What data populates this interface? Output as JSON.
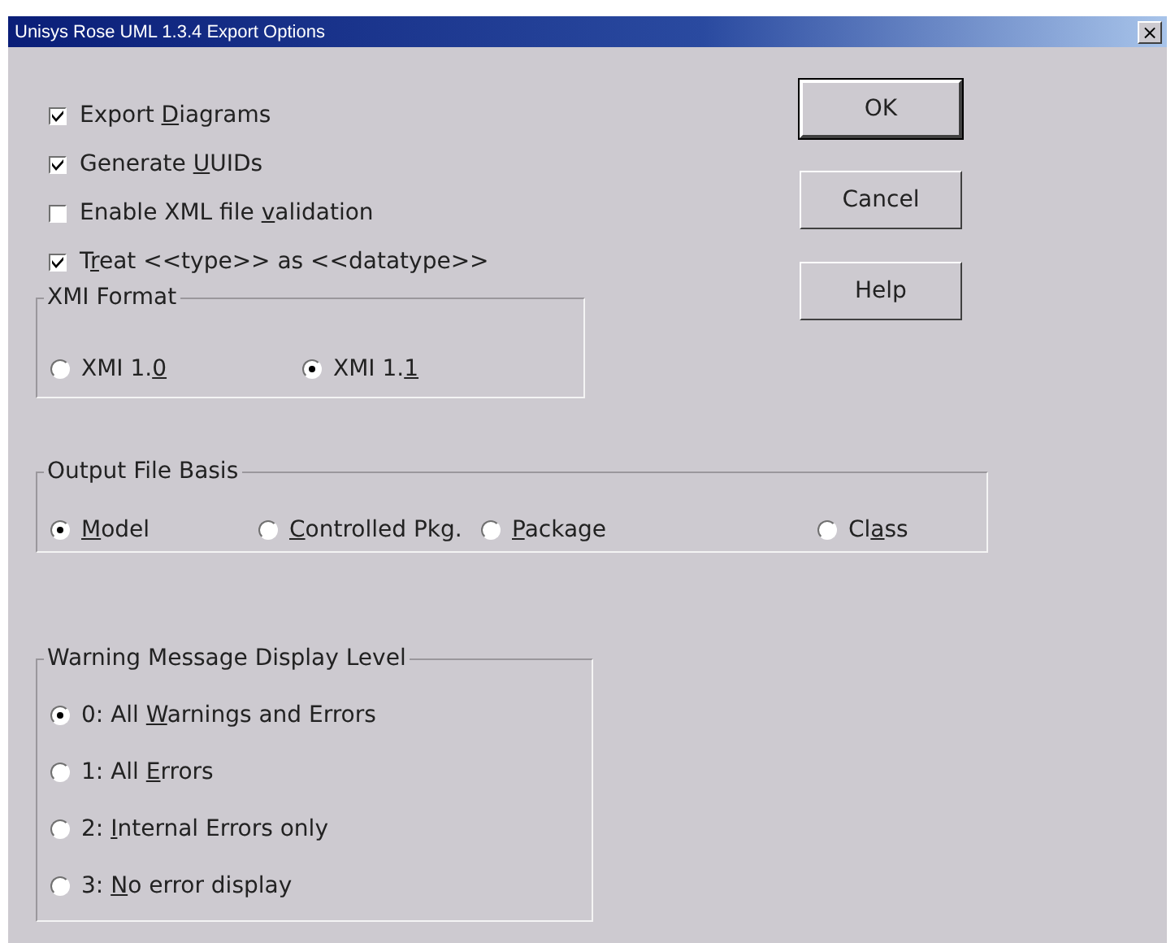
{
  "window": {
    "title": "Unisys Rose UML 1.3.4 Export Options",
    "close": "×"
  },
  "options": [
    {
      "label": {
        "before": "Export ",
        "key": "D",
        "after": "iagrams"
      },
      "checked": true
    },
    {
      "label": {
        "before": "Generate ",
        "key": "U",
        "after": "UIDs"
      },
      "checked": true
    },
    {
      "label": {
        "before": "Enable XML file ",
        "key": "v",
        "after": "alidation"
      },
      "checked": false
    },
    {
      "label": {
        "before": "T",
        "key": "r",
        "after": "eat <<type>> as <<datatype>>"
      },
      "checked": true
    }
  ],
  "buttons": [
    {
      "label": "OK",
      "default": true
    },
    {
      "label": "Cancel",
      "default": false
    },
    {
      "label": "Help",
      "default": false
    }
  ],
  "xmi_format": {
    "title": "XMI Format",
    "items": [
      {
        "label": {
          "before": "XMI 1.",
          "key": "0"
        },
        "selected": false
      },
      {
        "label": {
          "before": "XMI 1.",
          "key": "1"
        },
        "selected": true
      }
    ]
  },
  "output_file_basis": {
    "title": "Output File Basis",
    "items": [
      {
        "label": {
          "key": "M",
          "after": "odel"
        },
        "selected": true
      },
      {
        "label": {
          "key": "C",
          "after": "ontrolled Pkg."
        },
        "selected": false
      },
      {
        "label": {
          "key": "P",
          "after": "ackage"
        },
        "selected": false
      },
      {
        "label": {
          "before": "Cl",
          "key": "a",
          "after": "ss"
        },
        "selected": false
      }
    ]
  },
  "warning_level": {
    "title": "Warning Message Display Level",
    "items": [
      {
        "label": {
          "before": "0: All ",
          "key": "W",
          "after": "arnings and Errors"
        },
        "selected": true
      },
      {
        "label": {
          "before": "1: All ",
          "key": "E",
          "after": "rrors"
        },
        "selected": false
      },
      {
        "label": {
          "before": "2: ",
          "key": "I",
          "after": "nternal Errors only"
        },
        "selected": false
      },
      {
        "label": {
          "before": "3: ",
          "key": "N",
          "after": "o error display"
        },
        "selected": false
      }
    ]
  }
}
